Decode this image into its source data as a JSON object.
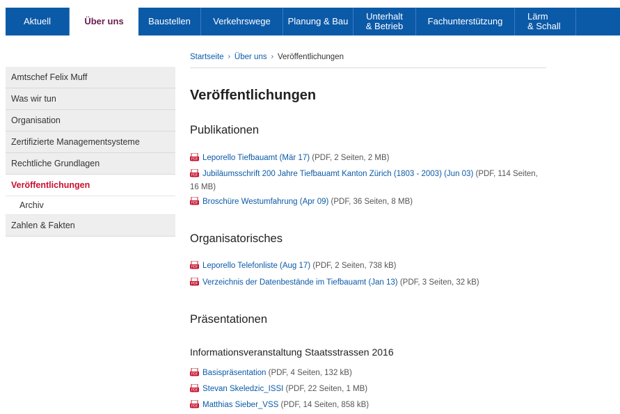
{
  "nav": {
    "items": [
      {
        "label": "Aktuell"
      },
      {
        "label": "Über uns"
      },
      {
        "label": "Baustellen"
      },
      {
        "label": "Verkehrswege"
      },
      {
        "label": "Planung & Bau"
      },
      {
        "label": "Unterhalt\n& Betrieb"
      },
      {
        "label": "Fachunterstützung"
      },
      {
        "label": "Lärm\n& Schall"
      }
    ]
  },
  "sidebar": {
    "items": [
      {
        "label": "Amtschef Felix Muff"
      },
      {
        "label": "Was wir tun"
      },
      {
        "label": "Organisation"
      },
      {
        "label": "Zertifizierte Managementsysteme"
      },
      {
        "label": "Rechtliche Grundlagen"
      },
      {
        "label": "Veröffentlichungen"
      },
      {
        "label": "Archiv"
      },
      {
        "label": "Zahlen & Fakten"
      }
    ]
  },
  "breadcrumb": {
    "items": [
      "Startseite",
      "Über uns",
      "Veröffentlichungen"
    ],
    "separator": "›"
  },
  "page_title": "Veröffentlichungen",
  "sections": {
    "publikationen": {
      "heading": "Publikationen",
      "items": [
        {
          "link": "Leporello Tiefbauamt (Mär 17)",
          "meta": " (PDF, 2 Seiten, 2 MB)"
        },
        {
          "link": "Jubiläumsschrift 200 Jahre Tiefbauamt Kanton Zürich (1803 - 2003) (Jun 03)",
          "meta": " (PDF, 114 Seiten, 16 MB)"
        },
        {
          "link": "Broschüre Westumfahrung (Apr 09)",
          "meta": " (PDF, 36 Seiten, 8 MB)"
        }
      ]
    },
    "organisatorisches": {
      "heading": "Organisatorisches",
      "items": [
        {
          "link": "Leporello Telefonliste (Aug 17)",
          "meta": " (PDF, 2 Seiten, 738 kB)"
        },
        {
          "link": "Verzeichnis der Datenbestände im Tiefbauamt (Jan 13)",
          "meta": " (PDF, 3 Seiten, 32 kB)"
        }
      ]
    },
    "praesentationen": {
      "heading": "Präsentationen",
      "subheading": "Informationsveranstaltung Staatsstrassen 2016",
      "items": [
        {
          "link": "Basispräsentation",
          "meta": " (PDF, 4 Seiten, 132 kB)"
        },
        {
          "link": "Stevan Skeledzic_ISSI",
          "meta": " (PDF, 22 Seiten, 1 MB)"
        },
        {
          "link": "Matthias Sieber_VSS",
          "meta": " (PDF, 14 Seiten, 858 kB)"
        }
      ]
    }
  },
  "icons": {
    "pdf": "pdf-file-icon"
  },
  "colors": {
    "nav_blue": "#0b5aa8",
    "active_text": "#6b1b4d",
    "sidebar_active": "#c8102e",
    "link": "#0b5aa8",
    "pdf_red": "#c8102e"
  }
}
